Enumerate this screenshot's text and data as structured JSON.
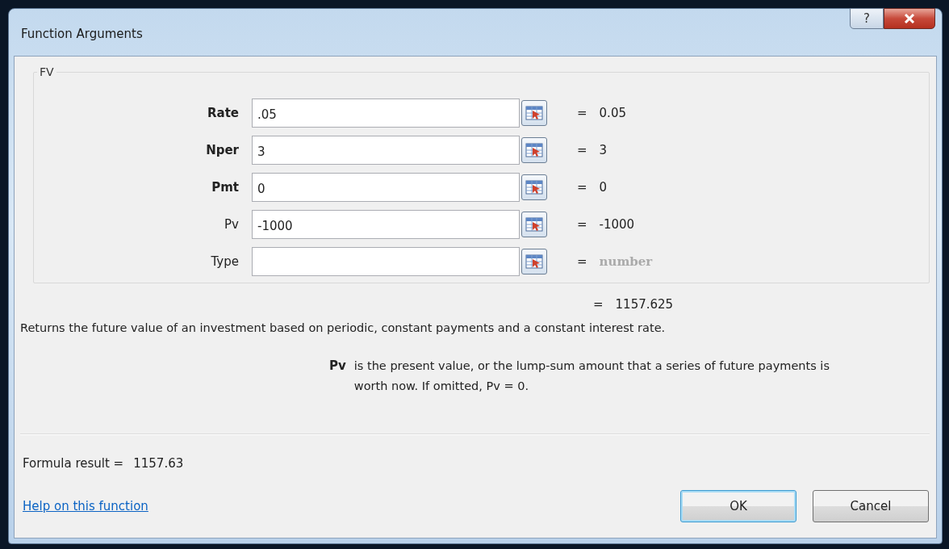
{
  "window": {
    "title": "Function Arguments"
  },
  "function": {
    "name": "FV"
  },
  "arguments": [
    {
      "label": "Rate",
      "required": true,
      "value": ".05",
      "result": "0.05",
      "result_greyed": false
    },
    {
      "label": "Nper",
      "required": true,
      "value": "3",
      "result": "3",
      "result_greyed": false
    },
    {
      "label": "Pmt",
      "required": true,
      "value": "0",
      "result": "0",
      "result_greyed": false
    },
    {
      "label": "Pv",
      "required": false,
      "value": "-1000",
      "result": "-1000",
      "result_greyed": false
    },
    {
      "label": "Type",
      "required": false,
      "result": "number",
      "result_greyed": true
    }
  ],
  "equals": "=",
  "function_result": "1157.625",
  "description": "Returns the future value of an investment based on periodic, constant payments and a constant interest rate.",
  "arg_help": {
    "name": "Pv",
    "text": "is the present value, or the lump-sum amount that a series of future payments is worth now. If omitted, Pv = 0."
  },
  "formula_result": {
    "label": "Formula result =",
    "value": "1157.63"
  },
  "help_link": "Help on this function",
  "buttons": [
    {
      "label": "OK",
      "default": true
    },
    {
      "label": "Cancel",
      "default": false
    }
  ],
  "title_buttons": {
    "help": "?"
  }
}
